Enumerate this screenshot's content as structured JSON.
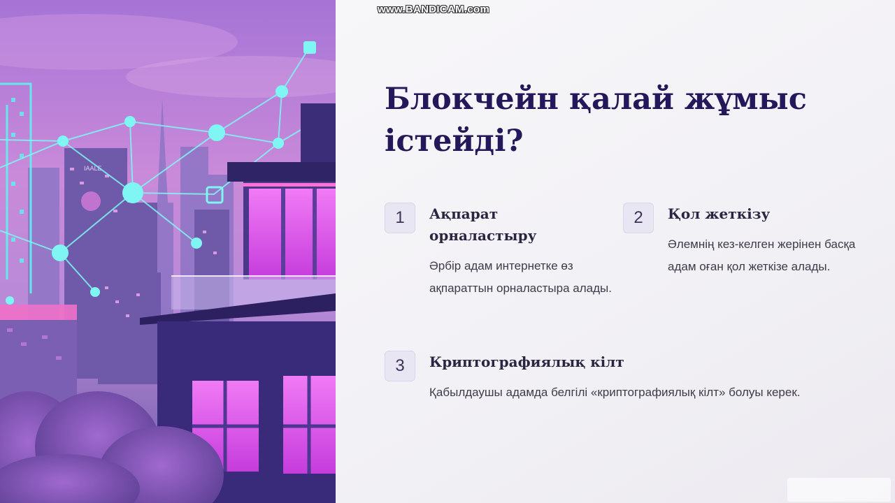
{
  "watermark": "www.BANDICAM.com",
  "title": "Блокчейн қалай жұмыс істейді?",
  "steps": [
    {
      "number": "1",
      "title": "Ақпарат орналастыру",
      "description": "Әрбір адам интернетке өз ақпараттын орналастыра алады."
    },
    {
      "number": "2",
      "title": "Қол жеткізу",
      "description": "Әлемнің кез-келген жерінен басқа адам оған қол жеткізе алады."
    },
    {
      "number": "3",
      "title": "Криптографиялық кілт",
      "description": "Қабылдаушы адамда белгілі «криптографиялық кілт» болуы керек."
    }
  ],
  "colors": {
    "title": "#24185a",
    "number_badge_bg": "#e8e6f2",
    "text": "#3d3b48",
    "neon_cyan": "#5ff3f0",
    "neon_magenta": "#e040f0"
  }
}
